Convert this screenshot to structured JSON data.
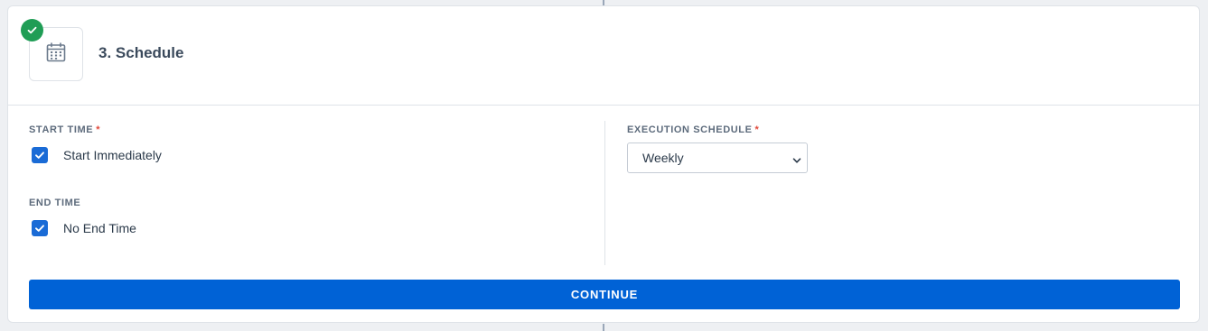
{
  "step": {
    "title": "3. Schedule",
    "status_icon": "check-circle-icon",
    "step_icon": "calendar-icon",
    "completed_color": "#1f9d55"
  },
  "start_time": {
    "label": "START TIME",
    "required_mark": "*",
    "checkbox_label": "Start Immediately",
    "checked": true
  },
  "end_time": {
    "label": "END TIME",
    "checkbox_label": "No End Time",
    "checked": true
  },
  "execution_schedule": {
    "label": "EXECUTION SCHEDULE",
    "required_mark": "*",
    "selected": "Weekly"
  },
  "actions": {
    "continue_label": "CONTINUE",
    "primary_color": "#0062d6"
  }
}
